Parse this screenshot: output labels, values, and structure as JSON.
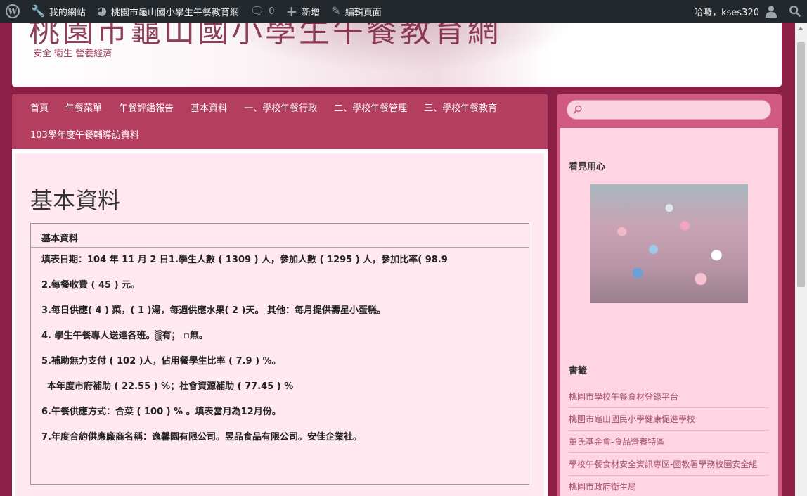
{
  "adminbar": {
    "my_site": "我的網站",
    "site_name": "桃園市龜山國小學生午餐教育網",
    "comments_count": "0",
    "new_label": "新增",
    "edit_label": "編輯頁面",
    "greeting": "哈囉，kses320"
  },
  "header": {
    "title": "桃園市龜山國小學生午餐教育網",
    "description": "安全 衛生 營養經濟"
  },
  "nav": {
    "items": [
      "首頁",
      "午餐菜單",
      "午餐評鑑報告",
      "基本資料",
      "一、學校午餐行政",
      "二、學校午餐管理",
      "三、學校午餐教育",
      "103學年度午餐輔導訪資料"
    ]
  },
  "page": {
    "title": "基本資料",
    "table_header": "基本資料",
    "rows": [
      "填表日期：104 年 11 月 2 日1.學生人數 ( 1309 ) 人，參加人數 (   1295  ) 人，參加比率(   98.9",
      "2.每餐收費 (  45   ) 元。",
      "3.每日供應( 4 ) 菜，( 1 )湯，每週供應水果( 2 )天。  其他：每月提供壽星小蛋糕。",
      "4. 學生午餐專人送達各班。▒有；  ▫無。",
      "5.補助無力支付 ( 102  )人，佔用餐學生比率 (    7.9    ) %。",
      "本年度市府補助 ( 22.55 ) %；社會資源補助 (    77.45   ) %",
      "6.午餐供應方式：合菜 (  100  ) % 。填表當月為12月份。",
      "7.年度合約供應廠商名稱：逸馨園有限公司。昱品食品有限公司。安佳企業社。"
    ]
  },
  "sidebar": {
    "search_placeholder": "",
    "widget1_title": "看見用心",
    "widget2_title": "書籤",
    "links": [
      "桃園市學校午餐食材登錄平台",
      "桃園市龜山國民小學健康促進學校",
      "董氏基金會-食品營養特區",
      "學校午餐食材安全資訊專區-國教署學務校園安全組",
      "桃園市政府衛生局"
    ]
  },
  "colors": {
    "accent": "#b33e5f",
    "background": "#8c1f45",
    "content_bg": "#ffe8ef"
  }
}
